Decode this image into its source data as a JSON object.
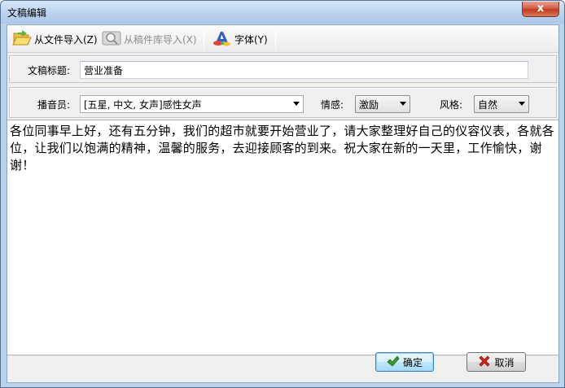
{
  "window": {
    "title": "文稿编辑",
    "close_glyph": "x"
  },
  "toolbar": {
    "import_file": "从文件导入(Z)",
    "import_library": "从稿件库导入(X)",
    "font": "字体(Y)"
  },
  "form": {
    "title_label": "文稿标题:",
    "title_value": "营业准备",
    "announcer_label": "播音员:",
    "announcer_value": "[五星, 中文, 女声]感性女声",
    "emotion_label": "情感:",
    "emotion_value": "激励",
    "style_label": "风格:",
    "style_value": "自然"
  },
  "editor": {
    "text": "各位同事早上好，还有五分钟，我们的超市就要开始营业了，请大家整理好自己的仪容仪表，各就各位，让我们以饱满的精神，温馨的服务，去迎接顾客的到来。祝大家在新的一天里，工作愉快，谢谢！"
  },
  "buttons": {
    "ok": "确定",
    "cancel": "取消"
  },
  "icons": {
    "import_file": "folder-open-icon",
    "import_library": "magnifier-library-icon",
    "font": "font-paint-icon",
    "ok": "checkmark-icon",
    "cancel": "red-x-icon"
  },
  "colors": {
    "title_bar": "#bcd3ee",
    "close": "#c0391f",
    "ok_check": "#3a9a2a",
    "cancel_x": "#d42a1e"
  }
}
